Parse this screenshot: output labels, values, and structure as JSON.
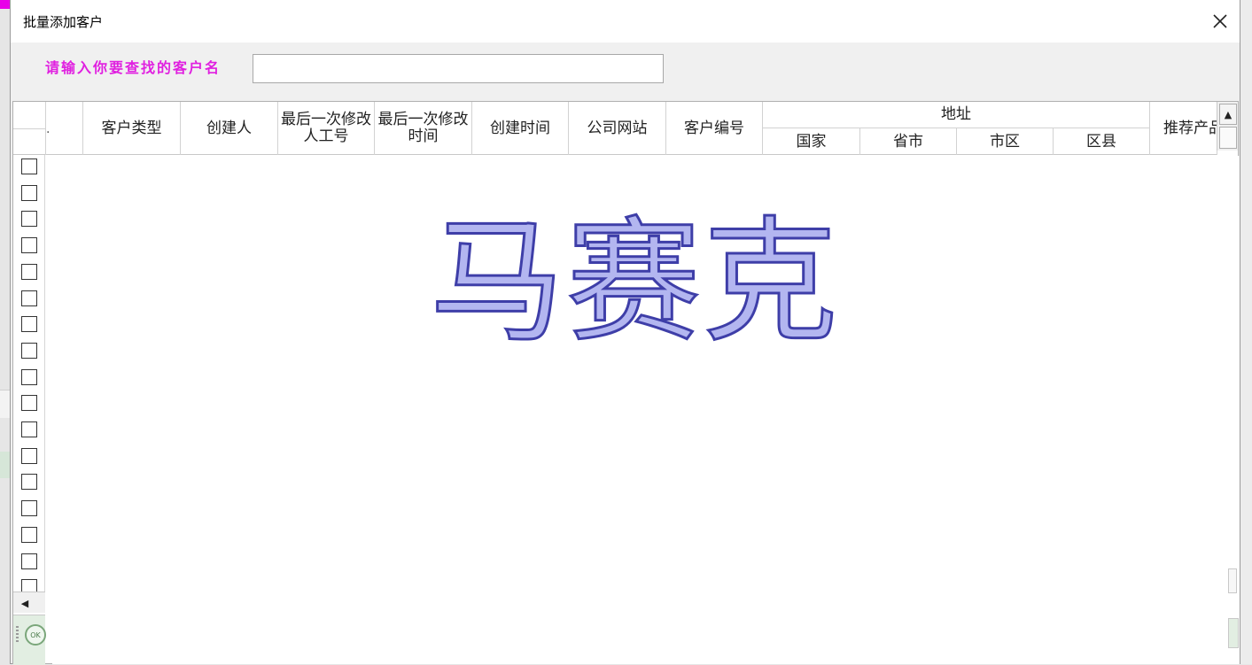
{
  "dialog": {
    "title": "批量添加客户",
    "close_symbol": "close-icon"
  },
  "search": {
    "label": "请输入你要查找的客户名",
    "value": "",
    "placeholder": ""
  },
  "table": {
    "rownum_header": ".",
    "columns": [
      {
        "key": "customer_type",
        "label": "客户类型"
      },
      {
        "key": "creator",
        "label": "创建人"
      },
      {
        "key": "last_modifier_id",
        "label": "最后一次修改人工号"
      },
      {
        "key": "last_modified_time",
        "label": "最后一次修改时间"
      },
      {
        "key": "created_time",
        "label": "创建时间"
      },
      {
        "key": "company_site",
        "label": "公司网站"
      },
      {
        "key": "customer_no",
        "label": "客户编号"
      },
      {
        "key": "address",
        "label": "地址",
        "sub": [
          "国家",
          "省市",
          "市区",
          "区县"
        ]
      },
      {
        "key": "recommender",
        "label": "推荐产品"
      }
    ],
    "visible_row_count": 17
  },
  "scroll": {
    "up_glyph": "▲",
    "left_glyph": "◀"
  },
  "footer": {
    "status_icon": "status-ok-icon",
    "status_glyph": "OK"
  },
  "watermark": {
    "text": "马赛克"
  }
}
